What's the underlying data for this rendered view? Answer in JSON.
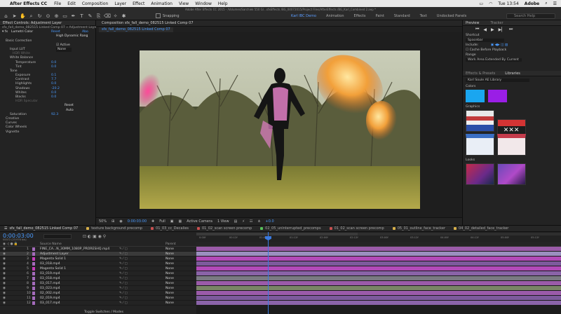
{
  "menubar": {
    "app": "After Effects CC",
    "items": [
      "File",
      "Edit",
      "Composition",
      "Layer",
      "Effect",
      "Animation",
      "View",
      "Window",
      "Help"
    ],
    "clock": "Tue 13:54",
    "brand": "Adobe"
  },
  "window_title": "Adobe After Effects CC 2015 - /Volumes/Sarchiek 550 G/...sfxEffects /BG_04072015/Project Files/AfterEffects /BG_Karl_Combined 2.aep *",
  "toolbar": {
    "snapping": "Snapping",
    "workspaces": [
      "Karl IBC Demo",
      "Animation",
      "Effects",
      "Paint",
      "Standard",
      "Text",
      "Undocked Panels"
    ],
    "active_workspace": "Karl IBC Demo",
    "search_placeholder": "Search Help"
  },
  "effect_controls": {
    "title": "Effect Controls: Adjustment Layer",
    "subtitle": "sfx_fall_demo_082515 Linked Comp 07 » Adjustment Layer",
    "fx_name": "Lumetri Color",
    "reset": "Reset",
    "about": "Abo",
    "high_range": "High Dynamic Rang",
    "basic_correction": "Basic Correction",
    "active": "Active",
    "input_lut": "Input LUT",
    "input_lut_val": "None",
    "hdr_white": "HDR White",
    "white_balance": "White Balance",
    "temperature": "Temperature",
    "temperature_val": "0.0",
    "tint": "Tint",
    "tint_val": "0.0",
    "tone": "Tone",
    "exposure": "Exposure",
    "exposure_val": "0.1",
    "contrast": "Contrast",
    "contrast_val": "7.7",
    "highlights": "Highlights",
    "highlights_val": "0.0",
    "shadows": "Shadows",
    "shadows_val": "-20.2",
    "whites": "Whites",
    "whites_val": "0.0",
    "blacks": "Blacks",
    "blacks_val": "0.0",
    "hdr_specular": "HDR Specular",
    "reset_btn": "Reset",
    "auto_btn": "Auto",
    "saturation": "Saturation",
    "saturation_val": "92.3",
    "creative": "Creative",
    "curves": "Curves",
    "color_wheels": "Color Wheels",
    "vignette": "Vignette"
  },
  "composition": {
    "tab_label": "Composition sfx_fall_demo_082515 Linked Comp 07",
    "sub_tab": "sfx_fall_demo_082515 Linked Comp 07",
    "zoom": "50%",
    "timecode": "0:00:03:00",
    "resolution": "Full",
    "camera": "Active Camera",
    "views": "1 View",
    "exposure": "+0.0"
  },
  "preview_panel": {
    "title": "Preview",
    "tracker": "Tracker",
    "shortcut_label": "Shortcut",
    "shortcut_val": "Spacebar",
    "include_label": "Include:",
    "cache_label": "Cache Before Playback",
    "range_label": "Range",
    "range_val": "Work Area Extended By Current"
  },
  "libraries": {
    "tab_effects": "Effects & Presets",
    "tab_libraries": "Libraries",
    "library_name": "Karl Soule AE Library",
    "colors_label": "Colors",
    "graphics_label": "Graphics",
    "looks_label": "Looks",
    "colors": [
      "#1aa6f0",
      "#9a1ee6"
    ]
  },
  "timeline": {
    "active_tab": "sfx_fall_demo_082515 Linked Comp 07",
    "tabs": [
      {
        "label": "texture background precomp",
        "color": "#d8b04a"
      },
      {
        "label": "01_03_cc_Decalies",
        "color": "#c95050"
      },
      {
        "label": "01_02_scan screen precomp",
        "color": "#c95050"
      },
      {
        "label": "02_05_uninterrupted_precomps",
        "color": "#56c15a"
      },
      {
        "label": "01_02_scan screen precomp",
        "color": "#c95050"
      },
      {
        "label": "05_01_outline_face_tracker",
        "color": "#d8b04a"
      },
      {
        "label": "04_02_detailed_face_tracker",
        "color": "#d8b04a"
      }
    ],
    "timecode": "0:00:03:00",
    "fps": "00072 (23.976 fps)",
    "col_source": "Source Name",
    "col_parent": "Parent",
    "footer": "Toggle Switches / Modes",
    "layers": [
      {
        "num": "1",
        "name": "FINE_CA...N_30MM_1080P_PRORESHQ.mp4",
        "color": "#a46bbb",
        "mode": "None"
      },
      {
        "num": "2",
        "name": "Adjustment Layer",
        "color": "#a46bbb",
        "mode": "None",
        "selected": true
      },
      {
        "num": "3",
        "name": "Magenta Solid 1",
        "color": "#c63ab8",
        "mode": "None"
      },
      {
        "num": "4",
        "name": "03_018.mp4",
        "color": "#a46bbb",
        "mode": "None"
      },
      {
        "num": "5",
        "name": "Magenta Solid 1",
        "color": "#c63ab8",
        "mode": "None"
      },
      {
        "num": "6",
        "name": "03_019.mp4",
        "color": "#a46bbb",
        "mode": "None"
      },
      {
        "num": "7",
        "name": "03_018.mp4",
        "color": "#a46bbb",
        "mode": "None"
      },
      {
        "num": "8",
        "name": "03_017.mp4",
        "color": "#a46bbb",
        "mode": "None"
      },
      {
        "num": "9",
        "name": "03_023.mp4",
        "color": "#a46bbb",
        "mode": "None"
      },
      {
        "num": "10",
        "name": "02_002.mp4",
        "color": "#a46bbb",
        "mode": "None"
      },
      {
        "num": "11",
        "name": "02_019.mp4",
        "color": "#a46bbb",
        "mode": "None"
      },
      {
        "num": "12",
        "name": "03_017.mp4",
        "color": "#a46bbb",
        "mode": "None"
      }
    ],
    "bar_colors": [
      "#9b5ba9",
      "#9b8fc0",
      "#b24ab8",
      "#7d5a9c",
      "#b24ab8",
      "#8a63a8",
      "#7a7a82",
      "#9b5ba9",
      "#7a8566",
      "#9b5ba9",
      "#7d5a9c",
      "#8a63a8"
    ],
    "ruler": [
      "0:00f",
      "00:12f",
      "01:00f",
      "01:12f",
      "02:00f",
      "02:12f",
      "03:00f",
      "03:12f",
      "04:00f",
      "04:12f",
      "05:00f",
      "05:12f"
    ]
  }
}
